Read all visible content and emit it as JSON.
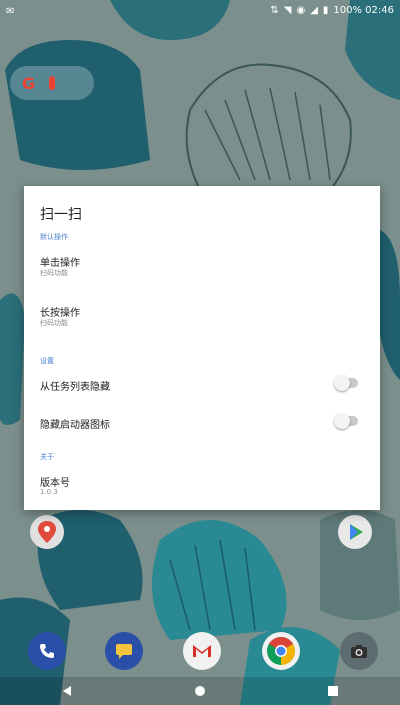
{
  "status_bar": {
    "left_icon": "notification-icon",
    "right_text": "100% 02:46"
  },
  "dialog": {
    "title": "扫一扫",
    "sections": [
      {
        "header": "默认操作",
        "items": [
          {
            "title": "单击操作",
            "subtitle": "扫码功能"
          },
          {
            "title": "长按操作",
            "subtitle": "扫码功能"
          }
        ]
      },
      {
        "header": "设置",
        "toggles": [
          {
            "label": "从任务列表隐藏",
            "on": false
          },
          {
            "label": "隐藏启动器图标",
            "on": false
          }
        ]
      },
      {
        "header": "关于",
        "items": [
          {
            "title": "版本号",
            "subtitle": "1.0.3"
          }
        ]
      }
    ]
  },
  "dock": {
    "apps": [
      "phone-icon",
      "messages-icon",
      "gmail-icon",
      "chrome-icon",
      "camera-icon"
    ]
  },
  "nav": {
    "back": "back-icon",
    "home": "home-icon",
    "recents": "recents-icon"
  },
  "colors": {
    "accent": "#4a7fd1",
    "wallpaper": "#7b8f8c",
    "shell": "#1f5f6e"
  }
}
